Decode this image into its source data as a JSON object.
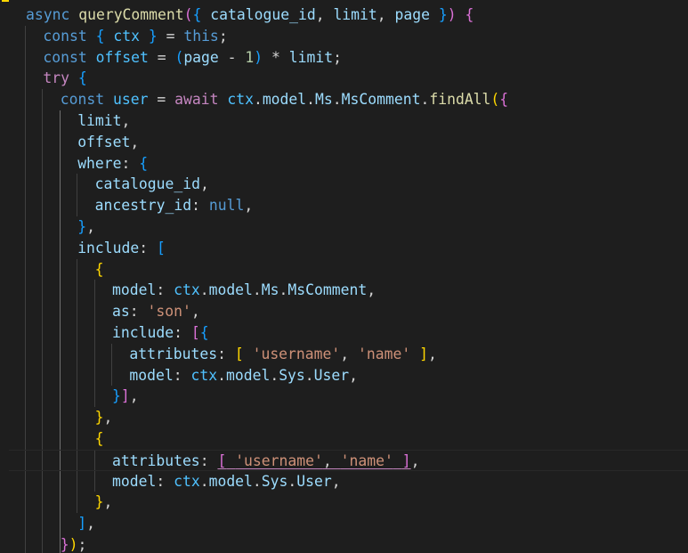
{
  "colors": {
    "background": "#1e1e1e",
    "keyword": "#569cd6",
    "control": "#c586c0",
    "function": "#dcdcaa",
    "variable": "#9cdcfe",
    "constant": "#4fc1ff",
    "type": "#4ec9b0",
    "string": "#ce9178",
    "number": "#b5cea8",
    "text": "#d4d4d4",
    "bracket_gold": "#ffd700",
    "bracket_pink": "#da70d6",
    "bracket_blue": "#179fff"
  },
  "code_lines": [
    [
      [
        "async",
        "keyword"
      ],
      [
        " ",
        "text"
      ],
      [
        "queryComment",
        "function"
      ],
      [
        "(",
        "bracket_pink"
      ],
      [
        "{",
        "bracket_blue"
      ],
      [
        " ",
        "text"
      ],
      [
        "catalogue_id",
        "variable"
      ],
      [
        ", ",
        "text"
      ],
      [
        "limit",
        "variable"
      ],
      [
        ", ",
        "text"
      ],
      [
        "page",
        "variable"
      ],
      [
        " ",
        "text"
      ],
      [
        "}",
        "bracket_blue"
      ],
      [
        ")",
        "bracket_pink"
      ],
      [
        " ",
        "text"
      ],
      [
        "{",
        "bracket_pink"
      ]
    ],
    [
      [
        "const",
        "keyword"
      ],
      [
        " ",
        "text"
      ],
      [
        "{",
        "bracket_blue"
      ],
      [
        " ",
        "text"
      ],
      [
        "ctx",
        "constant"
      ],
      [
        " ",
        "text"
      ],
      [
        "}",
        "bracket_blue"
      ],
      [
        " = ",
        "text"
      ],
      [
        "this",
        "keyword"
      ],
      [
        ";",
        "text"
      ]
    ],
    [
      [
        "const",
        "keyword"
      ],
      [
        " ",
        "text"
      ],
      [
        "offset",
        "constant"
      ],
      [
        " = ",
        "text"
      ],
      [
        "(",
        "bracket_blue"
      ],
      [
        "page",
        "variable"
      ],
      [
        " - ",
        "text"
      ],
      [
        "1",
        "number"
      ],
      [
        ")",
        "bracket_blue"
      ],
      [
        " * ",
        "text"
      ],
      [
        "limit",
        "variable"
      ],
      [
        ";",
        "text"
      ]
    ],
    [
      [
        "try",
        "control"
      ],
      [
        " ",
        "text"
      ],
      [
        "{",
        "bracket_blue"
      ]
    ],
    [
      [
        "const",
        "keyword"
      ],
      [
        " ",
        "text"
      ],
      [
        "user",
        "constant"
      ],
      [
        " = ",
        "text"
      ],
      [
        "await",
        "control"
      ],
      [
        " ",
        "text"
      ],
      [
        "ctx",
        "constant"
      ],
      [
        ".",
        "text"
      ],
      [
        "model",
        "variable"
      ],
      [
        ".",
        "text"
      ],
      [
        "Ms",
        "variable"
      ],
      [
        ".",
        "text"
      ],
      [
        "MsComment",
        "variable"
      ],
      [
        ".",
        "text"
      ],
      [
        "findAll",
        "function"
      ],
      [
        "(",
        "bracket_gold"
      ],
      [
        "{",
        "bracket_pink"
      ]
    ],
    [
      [
        "limit",
        "variable"
      ],
      [
        ",",
        "text"
      ]
    ],
    [
      [
        "offset",
        "variable"
      ],
      [
        ",",
        "text"
      ]
    ],
    [
      [
        "where",
        "variable"
      ],
      [
        ": ",
        "text"
      ],
      [
        "{",
        "bracket_blue"
      ]
    ],
    [
      [
        "catalogue_id",
        "variable"
      ],
      [
        ",",
        "text"
      ]
    ],
    [
      [
        "ancestry_id",
        "variable"
      ],
      [
        ": ",
        "text"
      ],
      [
        "null",
        "keyword"
      ],
      [
        ",",
        "text"
      ]
    ],
    [
      [
        "}",
        "bracket_blue"
      ],
      [
        ",",
        "text"
      ]
    ],
    [
      [
        "include",
        "variable"
      ],
      [
        ": ",
        "text"
      ],
      [
        "[",
        "bracket_blue"
      ]
    ],
    [
      [
        "{",
        "bracket_gold"
      ]
    ],
    [
      [
        "model",
        "variable"
      ],
      [
        ": ",
        "text"
      ],
      [
        "ctx",
        "constant"
      ],
      [
        ".",
        "text"
      ],
      [
        "model",
        "variable"
      ],
      [
        ".",
        "text"
      ],
      [
        "Ms",
        "variable"
      ],
      [
        ".",
        "text"
      ],
      [
        "MsComment",
        "variable"
      ],
      [
        ",",
        "text"
      ]
    ],
    [
      [
        "as",
        "variable"
      ],
      [
        ": ",
        "text"
      ],
      [
        "'son'",
        "string"
      ],
      [
        ",",
        "text"
      ]
    ],
    [
      [
        "include",
        "variable"
      ],
      [
        ": ",
        "text"
      ],
      [
        "[",
        "bracket_pink"
      ],
      [
        "{",
        "bracket_blue"
      ]
    ],
    [
      [
        "attributes",
        "variable"
      ],
      [
        ": ",
        "text"
      ],
      [
        "[",
        "bracket_gold"
      ],
      [
        " ",
        "text"
      ],
      [
        "'username'",
        "string"
      ],
      [
        ", ",
        "text"
      ],
      [
        "'name'",
        "string"
      ],
      [
        " ",
        "text"
      ],
      [
        "]",
        "bracket_gold"
      ],
      [
        ",",
        "text"
      ]
    ],
    [
      [
        "model",
        "variable"
      ],
      [
        ": ",
        "text"
      ],
      [
        "ctx",
        "constant"
      ],
      [
        ".",
        "text"
      ],
      [
        "model",
        "variable"
      ],
      [
        ".",
        "text"
      ],
      [
        "Sys",
        "variable"
      ],
      [
        ".",
        "text"
      ],
      [
        "User",
        "variable"
      ],
      [
        ",",
        "text"
      ]
    ],
    [
      [
        "}",
        "bracket_blue"
      ],
      [
        "]",
        "bracket_pink"
      ],
      [
        ",",
        "text"
      ]
    ],
    [
      [
        "}",
        "bracket_gold"
      ],
      [
        ",",
        "text"
      ]
    ],
    [
      [
        "{",
        "bracket_gold"
      ]
    ],
    [
      [
        "attributes",
        "variable"
      ],
      [
        ": ",
        "text"
      ],
      [
        "[",
        "bracket_pink"
      ],
      [
        " ",
        "text"
      ],
      [
        "'username'",
        "string"
      ],
      [
        ", ",
        "text"
      ],
      [
        "'name'",
        "string"
      ],
      [
        " ",
        "text"
      ],
      [
        "]",
        "bracket_pink"
      ],
      [
        ",",
        "text"
      ]
    ],
    [
      [
        "model",
        "variable"
      ],
      [
        ": ",
        "text"
      ],
      [
        "ctx",
        "constant"
      ],
      [
        ".",
        "text"
      ],
      [
        "model",
        "variable"
      ],
      [
        ".",
        "text"
      ],
      [
        "Sys",
        "variable"
      ],
      [
        ".",
        "text"
      ],
      [
        "User",
        "variable"
      ],
      [
        ",",
        "text"
      ]
    ],
    [
      [
        "}",
        "bracket_gold"
      ],
      [
        ",",
        "text"
      ]
    ],
    [
      [
        "]",
        "bracket_blue"
      ],
      [
        ",",
        "text"
      ]
    ],
    [
      [
        "}",
        "bracket_pink"
      ],
      [
        ")",
        "bracket_gold"
      ],
      [
        ";",
        "text"
      ]
    ]
  ]
}
